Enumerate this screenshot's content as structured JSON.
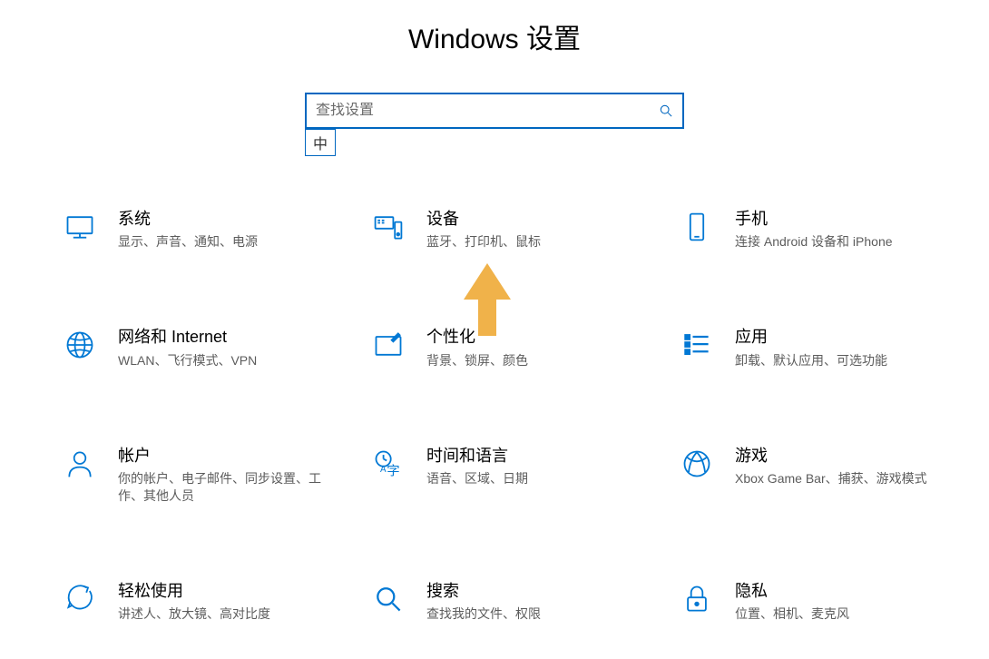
{
  "header": {
    "title": "Windows 设置"
  },
  "search": {
    "placeholder": "查找设置"
  },
  "ime": {
    "badge": "中"
  },
  "tiles": [
    {
      "title": "系统",
      "desc": "显示、声音、通知、电源"
    },
    {
      "title": "设备",
      "desc": "蓝牙、打印机、鼠标"
    },
    {
      "title": "手机",
      "desc": "连接 Android 设备和 iPhone"
    },
    {
      "title": "网络和 Internet",
      "desc": "WLAN、飞行模式、VPN"
    },
    {
      "title": "个性化",
      "desc": "背景、锁屏、颜色"
    },
    {
      "title": "应用",
      "desc": "卸载、默认应用、可选功能"
    },
    {
      "title": "帐户",
      "desc": "你的帐户、电子邮件、同步设置、工作、其他人员"
    },
    {
      "title": "时间和语言",
      "desc": "语音、区域、日期"
    },
    {
      "title": "游戏",
      "desc": "Xbox Game Bar、捕获、游戏模式"
    },
    {
      "title": "轻松使用",
      "desc": "讲述人、放大镜、高对比度"
    },
    {
      "title": "搜索",
      "desc": "查找我的文件、权限"
    },
    {
      "title": "隐私",
      "desc": "位置、相机、麦克风"
    }
  ],
  "colors": {
    "accent": "#0078d4",
    "border": "#0067c0",
    "arrow": "#f0b24a"
  }
}
